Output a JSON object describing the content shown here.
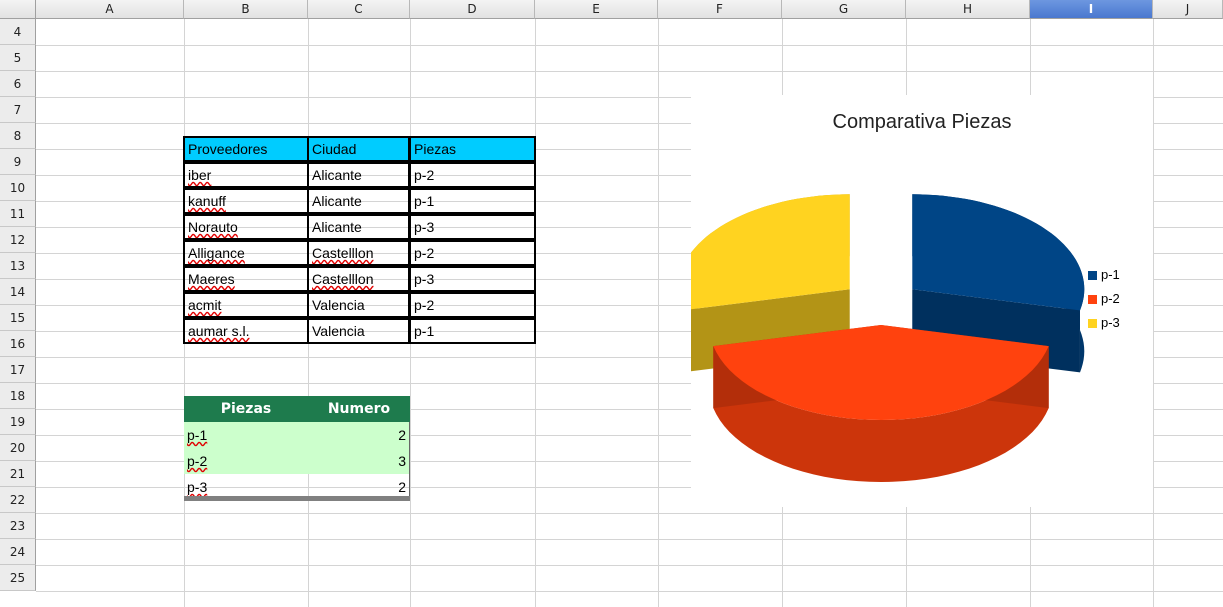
{
  "sheet": {
    "columns": [
      "A",
      "B",
      "C",
      "D",
      "E",
      "F",
      "G",
      "H",
      "I",
      "J"
    ],
    "active_column": "I",
    "rows": [
      "4",
      "5",
      "6",
      "7",
      "8",
      "9",
      "10",
      "11",
      "12",
      "13",
      "14",
      "15",
      "16",
      "17",
      "18",
      "19",
      "20",
      "21",
      "22",
      "23",
      "24",
      "25"
    ]
  },
  "suppliers_table": {
    "headers": [
      "Proveedores",
      "Ciudad",
      "Piezas"
    ],
    "rows": [
      [
        "iber",
        "Alicante",
        "p-2"
      ],
      [
        "kanuff",
        "Alicante",
        "p-1"
      ],
      [
        "Norauto",
        "Alicante",
        "p-3"
      ],
      [
        "Alligance",
        "Castelllon",
        "p-2"
      ],
      [
        "Maeres",
        "Castelllon",
        "p-3"
      ],
      [
        "acmit",
        "Valencia",
        "p-2"
      ],
      [
        "aumar s.l.",
        "Valencia",
        "p-1"
      ]
    ]
  },
  "count_table": {
    "headers": [
      "Piezas",
      "Numero"
    ],
    "rows": [
      [
        "p-1",
        "2"
      ],
      [
        "p-2",
        "3"
      ],
      [
        "p-3",
        "2"
      ]
    ]
  },
  "chart_data": {
    "type": "pie",
    "title": "Comparativa Piezas",
    "categories": [
      "p-1",
      "p-2",
      "p-3"
    ],
    "values": [
      2,
      3,
      2
    ],
    "colors": [
      "#004586",
      "#ff420e",
      "#ffd320"
    ],
    "legend_position": "right",
    "exploded": true,
    "three_d": true
  }
}
